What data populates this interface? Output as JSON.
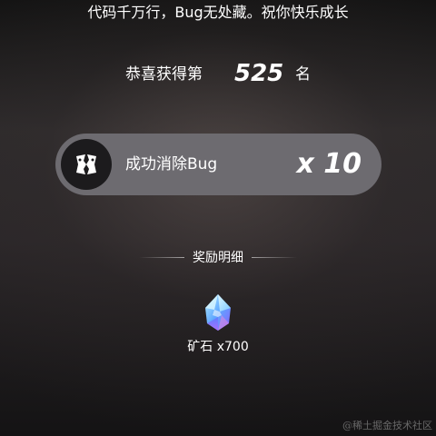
{
  "motto": "代码千万行，Bug无处藏。祝你快乐成长",
  "rank": {
    "prefix": "恭喜获得第",
    "number": "525",
    "suffix": "名"
  },
  "achievement": {
    "label": "成功消除Bug",
    "count": "x 10",
    "icon": "bug-badge-icon"
  },
  "rewards": {
    "title": "奖励明细",
    "items": [
      {
        "label": "矿石 x700",
        "icon": "ore-crystal-icon"
      }
    ]
  },
  "watermark": "@稀土掘金技术社区",
  "colors": {
    "card_background": "#6d6b70",
    "badge_background": "#1c1b1d",
    "text": "#ffffff"
  }
}
